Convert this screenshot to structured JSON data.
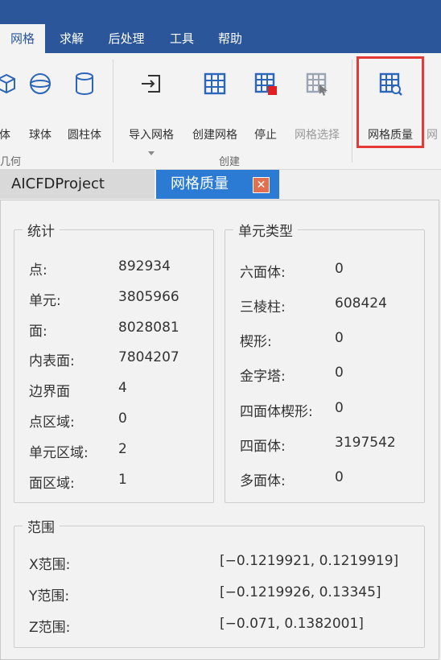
{
  "menu": {
    "tabs": [
      {
        "label": "网格",
        "active": true
      },
      {
        "label": "求解"
      },
      {
        "label": "后处理"
      },
      {
        "label": "工具"
      },
      {
        "label": "帮助"
      }
    ]
  },
  "ribbon": {
    "buttons": {
      "partial_body": "体",
      "sphere": "球体",
      "cylinder": "圆柱体",
      "import_mesh": "导入网格",
      "create_mesh": "创建网格",
      "stop": "停止",
      "mesh_select": "网格选择",
      "mesh_quality": "网格质量",
      "partial_next": "网"
    },
    "groups": {
      "geometry": "几何",
      "create": "创建"
    }
  },
  "doc_tabs": {
    "project": "AICFDProject",
    "quality": "网格质量",
    "close_glyph": "✕"
  },
  "stats": {
    "title": "统计",
    "rows": [
      {
        "label": "点:",
        "value": "892934"
      },
      {
        "label": "单元:",
        "value": "3805966"
      },
      {
        "label": "面:",
        "value": "8028081"
      },
      {
        "label": "内表面:",
        "value": "7804207"
      },
      {
        "label": "边界面",
        "value": "4"
      },
      {
        "label": "点区域:",
        "value": "0"
      },
      {
        "label": "单元区域:",
        "value": "2"
      },
      {
        "label": "面区域:",
        "value": "1"
      }
    ]
  },
  "cell_types": {
    "title": "单元类型",
    "rows": [
      {
        "label": "六面体:",
        "value": "0"
      },
      {
        "label": "三棱柱:",
        "value": "608424"
      },
      {
        "label": "楔形:",
        "value": "0"
      },
      {
        "label": "金字塔:",
        "value": "0"
      },
      {
        "label": "四面体楔形:",
        "value": "0"
      },
      {
        "label": "四面体:",
        "value": "3197542"
      },
      {
        "label": "多面体:",
        "value": "0"
      }
    ]
  },
  "range": {
    "title": "范围",
    "rows": [
      {
        "label": "X范围:",
        "value": "[−0.1219921, 0.1219919]"
      },
      {
        "label": "Y范围:",
        "value": "[−0.1219926, 0.13345]"
      },
      {
        "label": "Z范围:",
        "value": "[−0.071, 0.1382001]"
      }
    ]
  },
  "colors": {
    "title_bar": "#2b579a",
    "active_doc_tab": "#2b7bd4",
    "highlight": "#e53935",
    "icon_blue": "#2b66b8",
    "stop_red": "#e02020"
  }
}
